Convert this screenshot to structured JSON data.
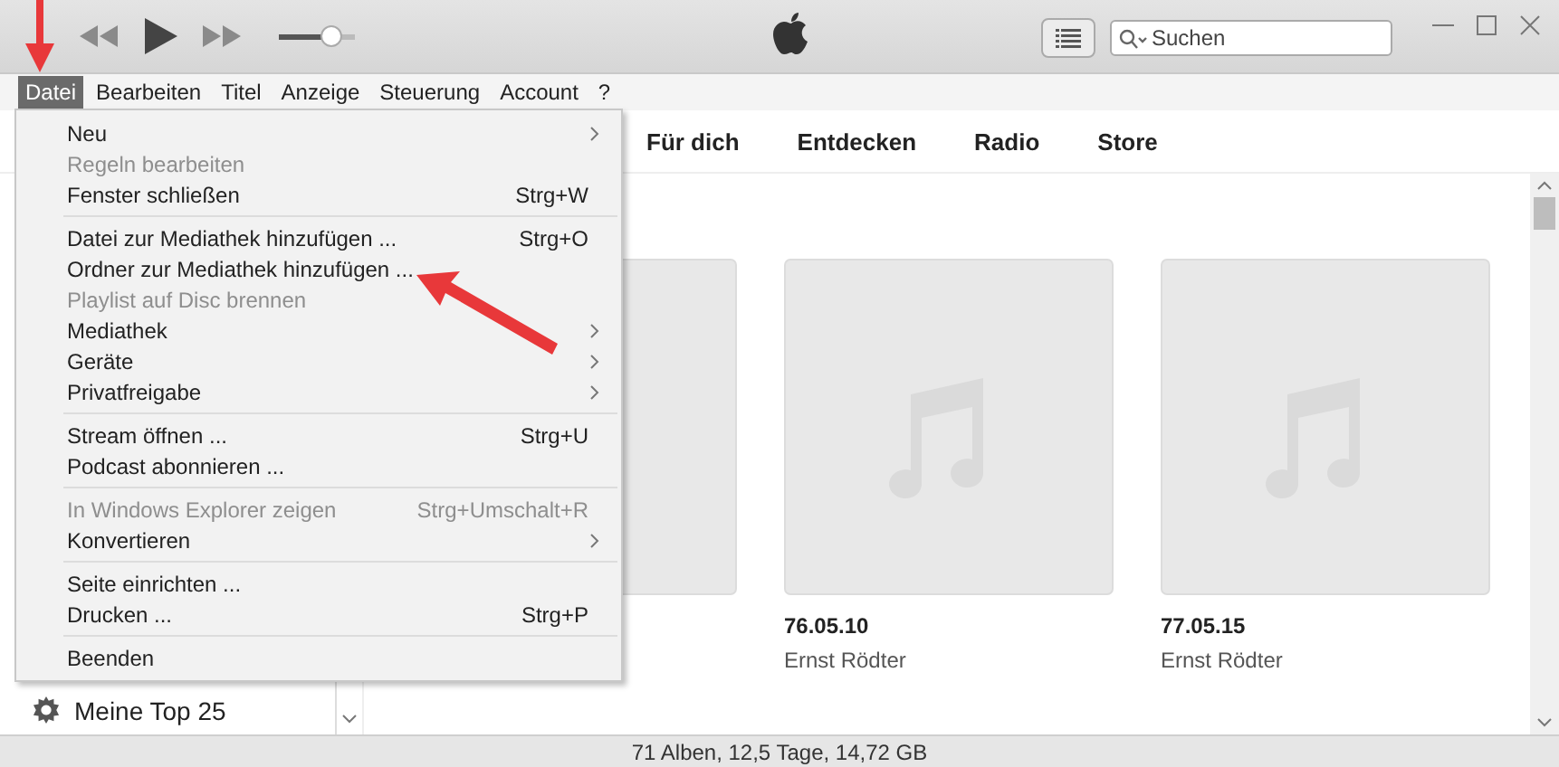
{
  "toolbar": {
    "volume": {
      "level": 0.7
    },
    "search": {
      "placeholder": "Suchen"
    }
  },
  "menubar": [
    {
      "label": "Datei",
      "selected": true
    },
    {
      "label": "Bearbeiten",
      "selected": false
    },
    {
      "label": "Titel",
      "selected": false
    },
    {
      "label": "Anzeige",
      "selected": false
    },
    {
      "label": "Steuerung",
      "selected": false
    },
    {
      "label": "Account",
      "selected": false
    },
    {
      "label": "?",
      "selected": false
    }
  ],
  "nav_tabs": [
    {
      "label": "Für dich"
    },
    {
      "label": "Entdecken"
    },
    {
      "label": "Radio"
    },
    {
      "label": "Store"
    }
  ],
  "sidebar": {
    "items": [
      {
        "label": "Meine Top 25"
      }
    ]
  },
  "albums": [
    {
      "kind": "picture"
    },
    {
      "kind": "picture",
      "title": "76.05.10",
      "artist": "Ernst Rödter"
    },
    {
      "kind": "picture",
      "title": "77.05.15",
      "artist": "Ernst Rödter"
    }
  ],
  "file_menu": [
    {
      "kind": "item",
      "label": "Neu",
      "submenu": true,
      "disabled": false
    },
    {
      "kind": "item",
      "label": "Regeln bearbeiten",
      "submenu": false,
      "disabled": true
    },
    {
      "kind": "item",
      "label": "Fenster schließen",
      "shortcut": "Strg+W",
      "submenu": false,
      "disabled": false
    },
    {
      "kind": "separator"
    },
    {
      "kind": "item",
      "label": "Datei zur Mediathek hinzufügen ...",
      "shortcut": "Strg+O",
      "submenu": false,
      "disabled": false
    },
    {
      "kind": "item",
      "label": "Ordner zur Mediathek hinzufügen ...",
      "submenu": false,
      "disabled": false
    },
    {
      "kind": "item",
      "label": "Playlist auf Disc brennen",
      "submenu": false,
      "disabled": true
    },
    {
      "kind": "item",
      "label": "Mediathek",
      "submenu": true,
      "disabled": false
    },
    {
      "kind": "item",
      "label": "Geräte",
      "submenu": true,
      "disabled": false
    },
    {
      "kind": "item",
      "label": "Privatfreigabe",
      "submenu": true,
      "disabled": false
    },
    {
      "kind": "separator"
    },
    {
      "kind": "item",
      "label": "Stream öffnen ...",
      "shortcut": "Strg+U",
      "submenu": false,
      "disabled": false
    },
    {
      "kind": "item",
      "label": "Podcast abonnieren ...",
      "submenu": false,
      "disabled": false
    },
    {
      "kind": "separator"
    },
    {
      "kind": "item",
      "label": "In Windows Explorer zeigen",
      "shortcut": "Strg+Umschalt+R",
      "submenu": false,
      "disabled": true
    },
    {
      "kind": "item",
      "label": "Konvertieren",
      "submenu": true,
      "disabled": false
    },
    {
      "kind": "separator"
    },
    {
      "kind": "item",
      "label": "Seite einrichten ...",
      "submenu": false,
      "disabled": false
    },
    {
      "kind": "item",
      "label": "Drucken ...",
      "shortcut": "Strg+P",
      "submenu": false,
      "disabled": false
    },
    {
      "kind": "separator"
    },
    {
      "kind": "item",
      "label": "Beenden",
      "submenu": false,
      "disabled": false
    }
  ],
  "status_bar": "71 Alben, 12,5 Tage, 14,72 GB"
}
